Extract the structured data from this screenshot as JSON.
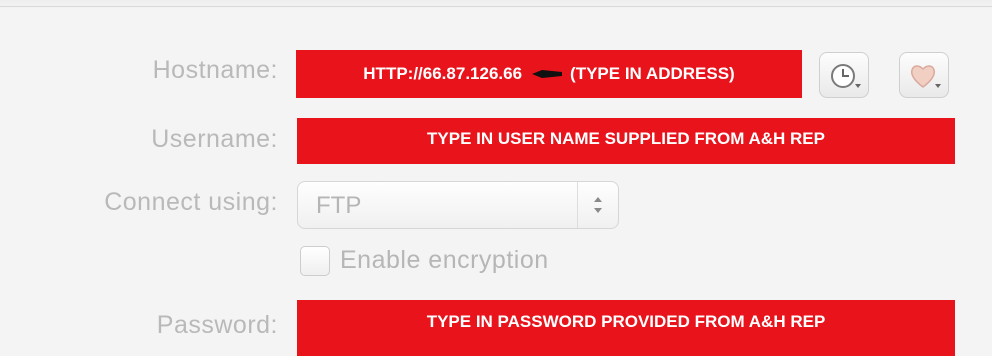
{
  "form": {
    "hostname": {
      "label": "Hostname:",
      "value_part1": "HTTP://66.87.126.66",
      "value_part2": "(TYPE IN ADDRESS)"
    },
    "username": {
      "label": "Username:",
      "value": "TYPE IN USER NAME SUPPLIED FROM A&H REP"
    },
    "connect_using": {
      "label": "Connect using:",
      "selected": "FTP"
    },
    "encryption": {
      "label": "Enable encryption",
      "checked": false
    },
    "password": {
      "label": "Password:",
      "value": "TYPE IN PASSWORD PROVIDED FROM A&H REP"
    }
  },
  "toolbar": {
    "history_icon": "clock-icon",
    "favorites_icon": "heart-icon"
  },
  "colors": {
    "annotation_red": "#e8131b",
    "label_gray": "#b9b9b9"
  }
}
